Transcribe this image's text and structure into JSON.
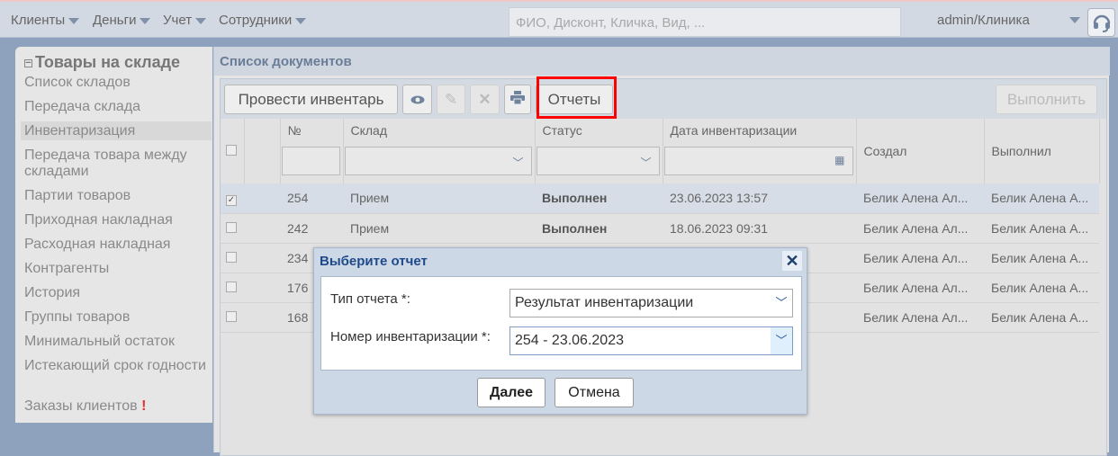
{
  "topbar": {
    "menus": [
      "Клиенты",
      "Деньги",
      "Учет",
      "Сотрудники"
    ],
    "search_placeholder": "ФИО, Дисконт, Кличка, Вид, ...",
    "user": "admin/Клиника"
  },
  "sidebar": {
    "title": "Товары на складе",
    "items": [
      "Список складов",
      "Передача склада",
      "Инвентаризация",
      "Передача товара между складами",
      "Партии товаров",
      "Приходная накладная",
      "Расходная накладная",
      "Контрагенты",
      "История",
      "Группы товаров",
      "Минимальный остаток",
      "Истекающий срок годности",
      "Заказы клиентов"
    ],
    "active": "Инвентаризация",
    "alert_mark": "!"
  },
  "main": {
    "title": "Список документов",
    "toolbar": {
      "inventory_label": "Провести инвентарь",
      "reports_label": "Отчеты",
      "execute_label": "Выполнить"
    },
    "columns": [
      "№",
      "Склад",
      "Статус",
      "Дата инвентаризации",
      "Создал",
      "Выполнил"
    ],
    "rows": [
      {
        "checked": true,
        "num": "254",
        "warehouse": "Прием",
        "status": "Выполнен",
        "date": "23.06.2023 13:57",
        "created": "Белик Алена Ал...",
        "done": "Белик Алена А..."
      },
      {
        "checked": false,
        "num": "242",
        "warehouse": "Прием",
        "status": "Выполнен",
        "date": "18.06.2023 09:31",
        "created": "Белик Алена Ал...",
        "done": "Белик Алена А..."
      },
      {
        "checked": false,
        "num": "234",
        "warehouse": "",
        "status": "",
        "date": "",
        "created": "Белик Алена Ал...",
        "done": "Белик Алена А..."
      },
      {
        "checked": false,
        "num": "176",
        "warehouse": "",
        "status": "",
        "date": "",
        "created": "Белик Алена Ал...",
        "done": "Белик Алена А..."
      },
      {
        "checked": false,
        "num": "168",
        "warehouse": "",
        "status": "",
        "date": "",
        "created": "Белик Алена Ал...",
        "done": "Белик Алена А..."
      }
    ]
  },
  "modal": {
    "title": "Выберите отчет",
    "report_type_label": "Тип отчета *:",
    "report_type_value": "Результат инвентаризации",
    "inv_number_label": "Номер инвентаризации *:",
    "inv_number_value": "254 - 23.06.2023",
    "next_label": "Далее",
    "cancel_label": "Отмена"
  }
}
